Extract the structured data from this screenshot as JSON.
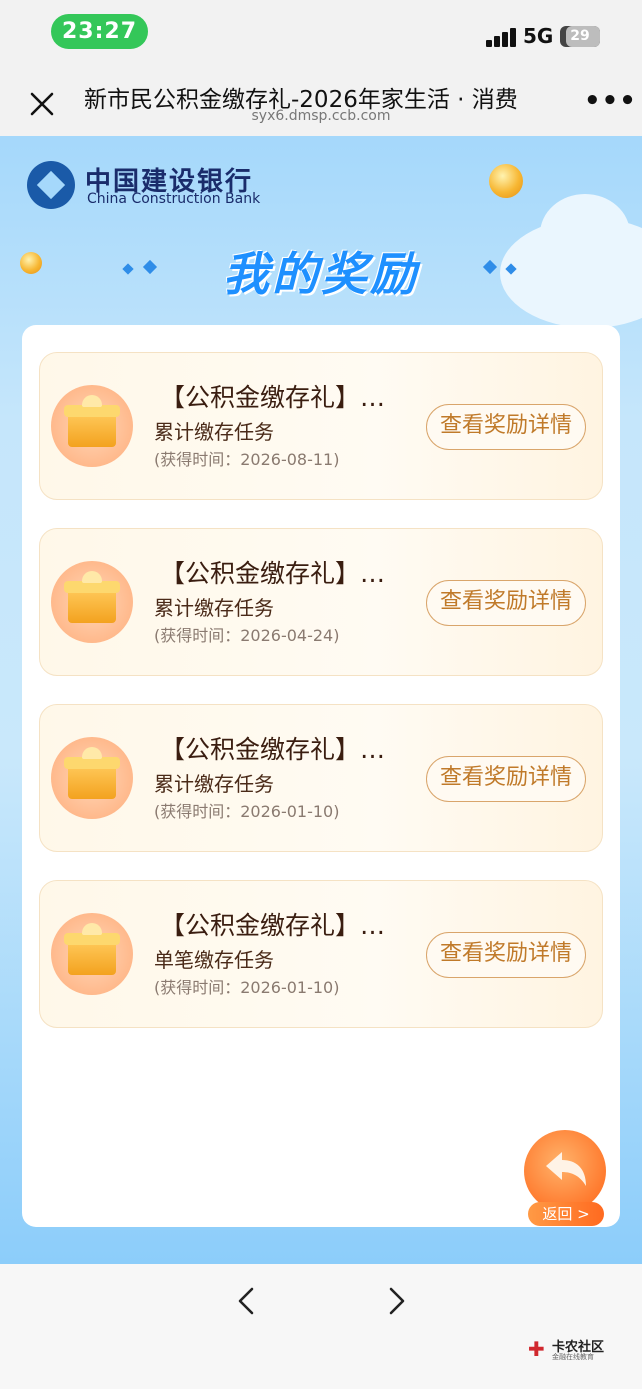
{
  "status_bar": {
    "time": "23:27",
    "network": "5G",
    "battery": "29"
  },
  "browser": {
    "title": "新市民公积金缴存礼-2026年家生活 · 消费",
    "url": "syx6.dmsp.ccb.com"
  },
  "bank": {
    "name_cn": "中国建设银行",
    "name_en": "China Construction Bank"
  },
  "page_title": "我的奖励",
  "rewards": [
    {
      "title": "【公积金缴存礼】…",
      "task": "累计缴存任务",
      "time": "(获得时间：2026-08-11)",
      "button": "查看奖励详情"
    },
    {
      "title": "【公积金缴存礼】…",
      "task": "累计缴存任务",
      "time": "(获得时间：2026-04-24)",
      "button": "查看奖励详情"
    },
    {
      "title": "【公积金缴存礼】…",
      "task": "累计缴存任务",
      "time": "(获得时间：2026-01-10)",
      "button": "查看奖励详情"
    },
    {
      "title": "【公积金缴存礼】…",
      "task": "单笔缴存任务",
      "time": "(获得时间：2026-01-10)",
      "button": "查看奖励详情"
    }
  ],
  "back_button": {
    "label": "返回 >"
  },
  "watermark": {
    "name": "卡农社区",
    "tagline": "金融在线教育"
  },
  "colors": {
    "status_pill": "#34c759",
    "accent_blue": "#1e90ff",
    "button_text": "#c07a2a",
    "back_button": "#ff7a2e"
  }
}
